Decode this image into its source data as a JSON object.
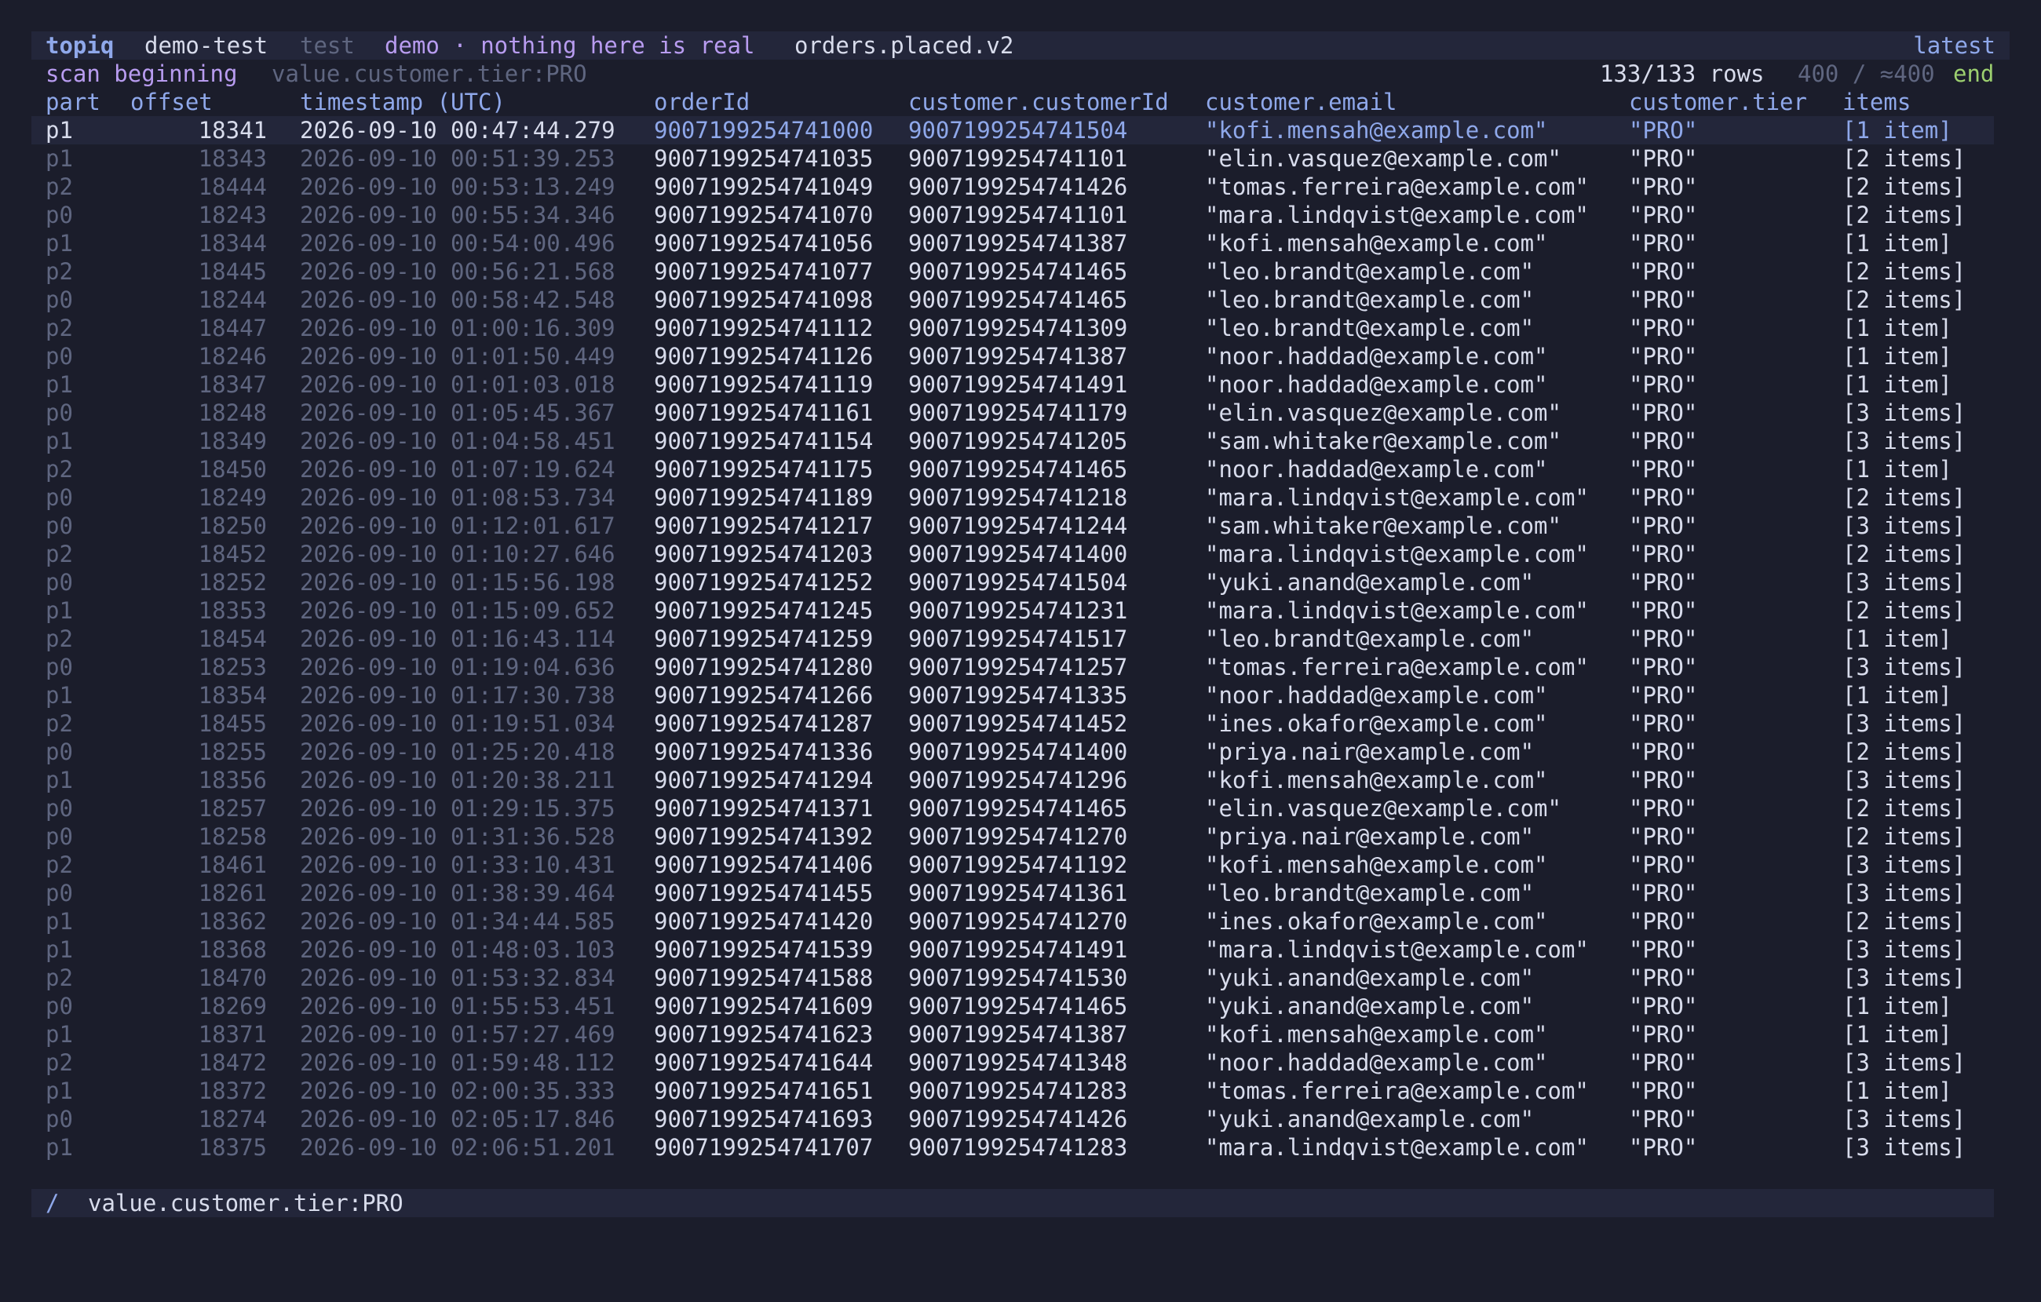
{
  "title": {
    "brand": "topiq",
    "cluster": "demo-test",
    "environment": "test",
    "context": "demo · nothing here is real",
    "topic": "orders.placed.v2",
    "position": "latest"
  },
  "status": {
    "scan": "scan beginning",
    "filter": "value.customer.tier:PRO",
    "row_count": "133/133 rows",
    "progress": "400 / ≈400",
    "end": "end"
  },
  "columns": [
    "part",
    "offset",
    "timestamp (UTC)",
    "orderId",
    "customer.customerId",
    "customer.email",
    "customer.tier",
    "items"
  ],
  "rows": [
    [
      "p1",
      "18341",
      "2026-09-10 00:47:44.279",
      "9007199254741000",
      "9007199254741504",
      "\"kofi.mensah@example.com\"",
      "\"PRO\"",
      "[1 item]"
    ],
    [
      "p1",
      "18343",
      "2026-09-10 00:51:39.253",
      "9007199254741035",
      "9007199254741101",
      "\"elin.vasquez@example.com\"",
      "\"PRO\"",
      "[2 items]"
    ],
    [
      "p2",
      "18444",
      "2026-09-10 00:53:13.249",
      "9007199254741049",
      "9007199254741426",
      "\"tomas.ferreira@example.com\"",
      "\"PRO\"",
      "[2 items]"
    ],
    [
      "p0",
      "18243",
      "2026-09-10 00:55:34.346",
      "9007199254741070",
      "9007199254741101",
      "\"mara.lindqvist@example.com\"",
      "\"PRO\"",
      "[2 items]"
    ],
    [
      "p1",
      "18344",
      "2026-09-10 00:54:00.496",
      "9007199254741056",
      "9007199254741387",
      "\"kofi.mensah@example.com\"",
      "\"PRO\"",
      "[1 item]"
    ],
    [
      "p2",
      "18445",
      "2026-09-10 00:56:21.568",
      "9007199254741077",
      "9007199254741465",
      "\"leo.brandt@example.com\"",
      "\"PRO\"",
      "[2 items]"
    ],
    [
      "p0",
      "18244",
      "2026-09-10 00:58:42.548",
      "9007199254741098",
      "9007199254741465",
      "\"leo.brandt@example.com\"",
      "\"PRO\"",
      "[2 items]"
    ],
    [
      "p2",
      "18447",
      "2026-09-10 01:00:16.309",
      "9007199254741112",
      "9007199254741309",
      "\"leo.brandt@example.com\"",
      "\"PRO\"",
      "[1 item]"
    ],
    [
      "p0",
      "18246",
      "2026-09-10 01:01:50.449",
      "9007199254741126",
      "9007199254741387",
      "\"noor.haddad@example.com\"",
      "\"PRO\"",
      "[1 item]"
    ],
    [
      "p1",
      "18347",
      "2026-09-10 01:01:03.018",
      "9007199254741119",
      "9007199254741491",
      "\"noor.haddad@example.com\"",
      "\"PRO\"",
      "[1 item]"
    ],
    [
      "p0",
      "18248",
      "2026-09-10 01:05:45.367",
      "9007199254741161",
      "9007199254741179",
      "\"elin.vasquez@example.com\"",
      "\"PRO\"",
      "[3 items]"
    ],
    [
      "p1",
      "18349",
      "2026-09-10 01:04:58.451",
      "9007199254741154",
      "9007199254741205",
      "\"sam.whitaker@example.com\"",
      "\"PRO\"",
      "[3 items]"
    ],
    [
      "p2",
      "18450",
      "2026-09-10 01:07:19.624",
      "9007199254741175",
      "9007199254741465",
      "\"noor.haddad@example.com\"",
      "\"PRO\"",
      "[1 item]"
    ],
    [
      "p0",
      "18249",
      "2026-09-10 01:08:53.734",
      "9007199254741189",
      "9007199254741218",
      "\"mara.lindqvist@example.com\"",
      "\"PRO\"",
      "[2 items]"
    ],
    [
      "p0",
      "18250",
      "2026-09-10 01:12:01.617",
      "9007199254741217",
      "9007199254741244",
      "\"sam.whitaker@example.com\"",
      "\"PRO\"",
      "[3 items]"
    ],
    [
      "p2",
      "18452",
      "2026-09-10 01:10:27.646",
      "9007199254741203",
      "9007199254741400",
      "\"mara.lindqvist@example.com\"",
      "\"PRO\"",
      "[2 items]"
    ],
    [
      "p0",
      "18252",
      "2026-09-10 01:15:56.198",
      "9007199254741252",
      "9007199254741504",
      "\"yuki.anand@example.com\"",
      "\"PRO\"",
      "[3 items]"
    ],
    [
      "p1",
      "18353",
      "2026-09-10 01:15:09.652",
      "9007199254741245",
      "9007199254741231",
      "\"mara.lindqvist@example.com\"",
      "\"PRO\"",
      "[2 items]"
    ],
    [
      "p2",
      "18454",
      "2026-09-10 01:16:43.114",
      "9007199254741259",
      "9007199254741517",
      "\"leo.brandt@example.com\"",
      "\"PRO\"",
      "[1 item]"
    ],
    [
      "p0",
      "18253",
      "2026-09-10 01:19:04.636",
      "9007199254741280",
      "9007199254741257",
      "\"tomas.ferreira@example.com\"",
      "\"PRO\"",
      "[3 items]"
    ],
    [
      "p1",
      "18354",
      "2026-09-10 01:17:30.738",
      "9007199254741266",
      "9007199254741335",
      "\"noor.haddad@example.com\"",
      "\"PRO\"",
      "[1 item]"
    ],
    [
      "p2",
      "18455",
      "2026-09-10 01:19:51.034",
      "9007199254741287",
      "9007199254741452",
      "\"ines.okafor@example.com\"",
      "\"PRO\"",
      "[3 items]"
    ],
    [
      "p0",
      "18255",
      "2026-09-10 01:25:20.418",
      "9007199254741336",
      "9007199254741400",
      "\"priya.nair@example.com\"",
      "\"PRO\"",
      "[2 items]"
    ],
    [
      "p1",
      "18356",
      "2026-09-10 01:20:38.211",
      "9007199254741294",
      "9007199254741296",
      "\"kofi.mensah@example.com\"",
      "\"PRO\"",
      "[3 items]"
    ],
    [
      "p0",
      "18257",
      "2026-09-10 01:29:15.375",
      "9007199254741371",
      "9007199254741465",
      "\"elin.vasquez@example.com\"",
      "\"PRO\"",
      "[2 items]"
    ],
    [
      "p0",
      "18258",
      "2026-09-10 01:31:36.528",
      "9007199254741392",
      "9007199254741270",
      "\"priya.nair@example.com\"",
      "\"PRO\"",
      "[2 items]"
    ],
    [
      "p2",
      "18461",
      "2026-09-10 01:33:10.431",
      "9007199254741406",
      "9007199254741192",
      "\"kofi.mensah@example.com\"",
      "\"PRO\"",
      "[3 items]"
    ],
    [
      "p0",
      "18261",
      "2026-09-10 01:38:39.464",
      "9007199254741455",
      "9007199254741361",
      "\"leo.brandt@example.com\"",
      "\"PRO\"",
      "[3 items]"
    ],
    [
      "p1",
      "18362",
      "2026-09-10 01:34:44.585",
      "9007199254741420",
      "9007199254741270",
      "\"ines.okafor@example.com\"",
      "\"PRO\"",
      "[2 items]"
    ],
    [
      "p1",
      "18368",
      "2026-09-10 01:48:03.103",
      "9007199254741539",
      "9007199254741491",
      "\"mara.lindqvist@example.com\"",
      "\"PRO\"",
      "[3 items]"
    ],
    [
      "p2",
      "18470",
      "2026-09-10 01:53:32.834",
      "9007199254741588",
      "9007199254741530",
      "\"yuki.anand@example.com\"",
      "\"PRO\"",
      "[3 items]"
    ],
    [
      "p0",
      "18269",
      "2026-09-10 01:55:53.451",
      "9007199254741609",
      "9007199254741465",
      "\"yuki.anand@example.com\"",
      "\"PRO\"",
      "[1 item]"
    ],
    [
      "p1",
      "18371",
      "2026-09-10 01:57:27.469",
      "9007199254741623",
      "9007199254741387",
      "\"kofi.mensah@example.com\"",
      "\"PRO\"",
      "[1 item]"
    ],
    [
      "p2",
      "18472",
      "2026-09-10 01:59:48.112",
      "9007199254741644",
      "9007199254741348",
      "\"noor.haddad@example.com\"",
      "\"PRO\"",
      "[3 items]"
    ],
    [
      "p1",
      "18372",
      "2026-09-10 02:00:35.333",
      "9007199254741651",
      "9007199254741283",
      "\"tomas.ferreira@example.com\"",
      "\"PRO\"",
      "[1 item]"
    ],
    [
      "p0",
      "18274",
      "2026-09-10 02:05:17.846",
      "9007199254741693",
      "9007199254741426",
      "\"yuki.anand@example.com\"",
      "\"PRO\"",
      "[3 items]"
    ],
    [
      "p1",
      "18375",
      "2026-09-10 02:06:51.201",
      "9007199254741707",
      "9007199254741283",
      "\"mara.lindqvist@example.com\"",
      "\"PRO\"",
      "[3 items]"
    ]
  ],
  "filterbar": {
    "prompt": "/",
    "query": "value.customer.tier:PRO"
  },
  "colors": {
    "background": "#1b1d2b",
    "bar": "#23263a",
    "accent": "#8fa8ea",
    "purple": "#b89cf0",
    "green": "#9ccf6f",
    "dim": "#5f6680",
    "text": "#d8dcec"
  }
}
